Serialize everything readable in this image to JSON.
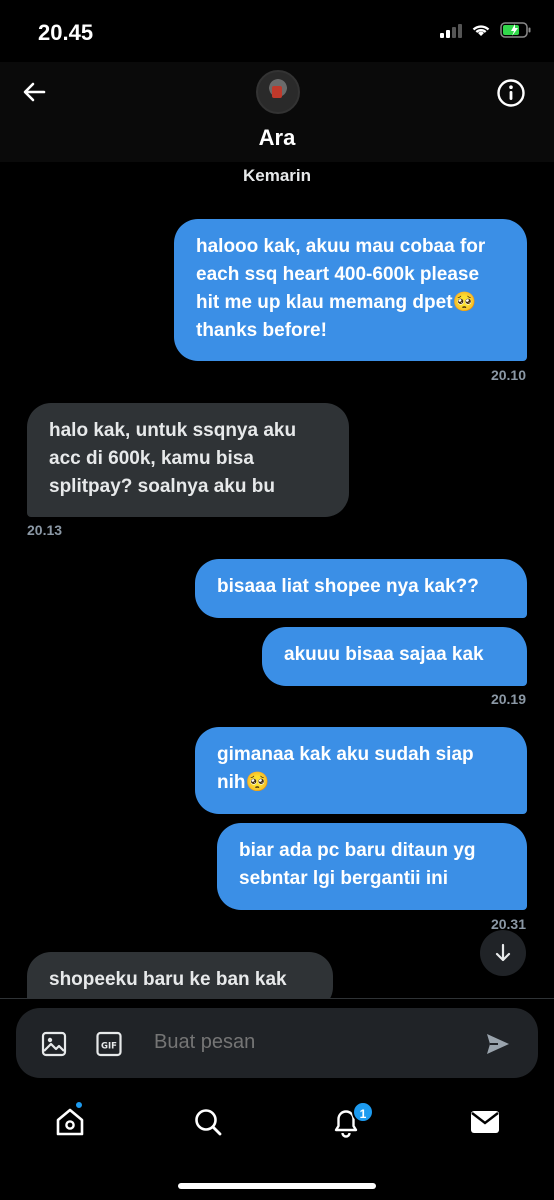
{
  "status": {
    "time": "20.45"
  },
  "header": {
    "name": "Ara"
  },
  "date_label": "Kemarin",
  "messages": [
    {
      "dir": "out",
      "text": "halooo kak, akuu mau cobaa for each ssq heart 400-600k please hit me up klau memang dpet🥺 thanks before!",
      "time": "20.10"
    },
    {
      "dir": "in",
      "text": "halo kak, untuk ssqnya aku acc di 600k, kamu bisa splitpay? soalnya aku bu",
      "time": "20.13"
    },
    {
      "dir": "out",
      "text": "bisaaa liat shopee nya kak??"
    },
    {
      "dir": "out",
      "text": "akuuu bisaa sajaa kak",
      "time": "20.19"
    },
    {
      "dir": "out",
      "text": "gimanaa kak aku sudah siap nih🥺"
    },
    {
      "dir": "out",
      "text": "biar ada pc baru ditaun yg sebntar lgi bergantii ini",
      "time": "20.31"
    },
    {
      "dir": "in",
      "text": "shopeeku baru ke ban kak"
    }
  ],
  "composer": {
    "placeholder": "Buat pesan"
  },
  "tabs": {
    "notifications_badge": "1"
  },
  "colors": {
    "outgoing": "#3b8fe6",
    "incoming": "#2f3336",
    "accent": "#1d9bf0"
  },
  "icons": [
    "back-arrow-icon",
    "info-icon",
    "image-icon",
    "gif-icon",
    "send-icon",
    "home-icon",
    "search-icon",
    "bell-icon",
    "mail-icon",
    "arrow-down-icon"
  ]
}
